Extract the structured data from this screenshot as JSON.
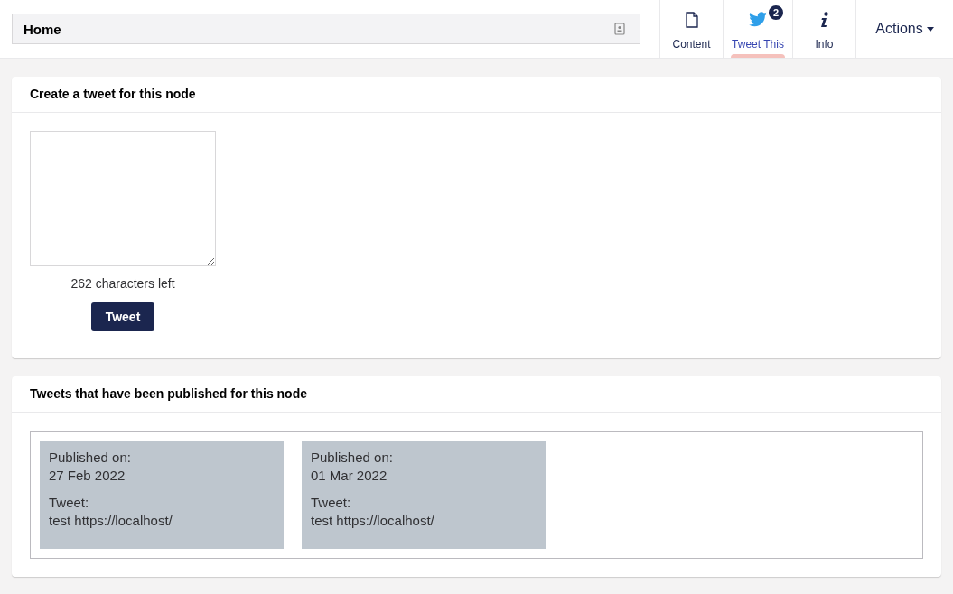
{
  "header": {
    "name_value": "Home"
  },
  "tabs": [
    {
      "kind": "document",
      "label": "Content",
      "selected": false
    },
    {
      "kind": "bird",
      "label": "Tweet This",
      "selected": true,
      "badge": "2"
    },
    {
      "kind": "info",
      "label": "Info",
      "selected": false
    }
  ],
  "actions": {
    "label": "Actions"
  },
  "compose": {
    "title": "Create a tweet for this node",
    "counter": "262 characters left",
    "button": "Tweet"
  },
  "published": {
    "title": "Tweets that have been published for this node",
    "tweets": [
      {
        "date_label": "Published on:",
        "date": "27 Feb 2022",
        "tweet_label": "Tweet:",
        "text": "test https://localhost/"
      },
      {
        "date_label": "Published on:",
        "date": "01 Mar 2022",
        "tweet_label": "Tweet:",
        "text": "test https://localhost/"
      }
    ]
  }
}
